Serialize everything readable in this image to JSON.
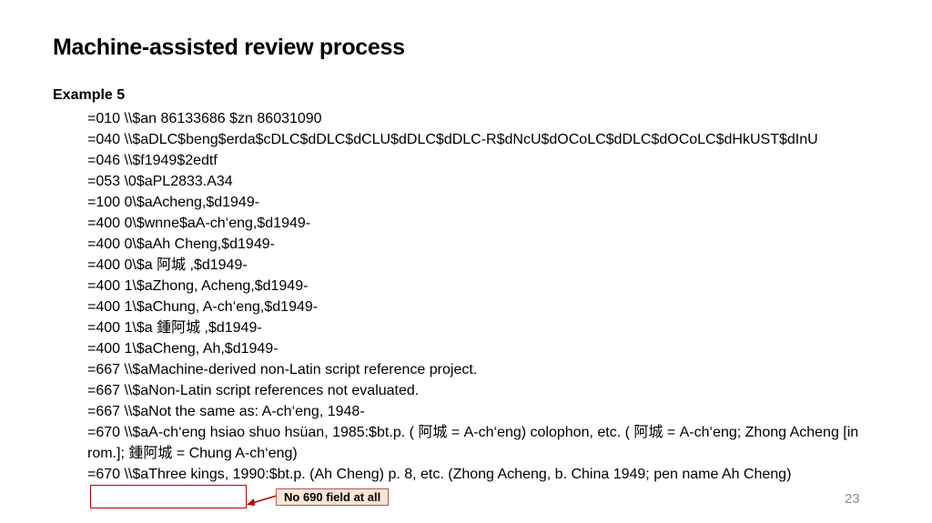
{
  "slide": {
    "title": "Machine-assisted review process",
    "example_label": "Example 5",
    "lines": [
      "=010  \\\\$an  86133686 $zn  86031090",
      "=040  \\\\$aDLC$beng$erda$cDLC$dDLC$dCLU$dDLC$dDLC-R$dNcU$dOCoLC$dDLC$dOCoLC$dHkUST$dInU",
      "=046  \\\\$f1949$2edtf",
      "=053  \\0$aPL2833.A34",
      "=100  0\\$aAcheng,$d1949-",
      "=400  0\\$wnne$aA-ch‘eng,$d1949-",
      "=400  0\\$aAh Cheng,$d1949-",
      "=400  0\\$a 阿城 ,$d1949-",
      "=400  1\\$aZhong, Acheng,$d1949-",
      "=400  1\\$aChung, A-ch‘eng,$d1949-",
      "=400  1\\$a 鍾阿城 ,$d1949-",
      "=400  1\\$aCheng, Ah,$d1949-",
      "=667  \\\\$aMachine-derived non-Latin script reference project.",
      "=667  \\\\$aNon-Latin script references not evaluated.",
      "=667  \\\\$aNot the same as: A-ch‘eng, 1948-",
      "=670  \\\\$aA-ch‘eng hsiao shuo hsüan, 1985:$bt.p. ( 阿城  = A-ch‘eng) colophon, etc. ( 阿城  = A-ch‘eng; Zhong Acheng [in rom.];  鍾阿城  = Chung A-ch‘eng)",
      "=670  \\\\$aThree kings, 1990:$bt.p. (Ah Cheng) p. 8, etc. (Zhong Acheng, b. China 1949; pen name Ah Cheng)"
    ],
    "callout": "No 690 field at all",
    "page_number": "23",
    "colors": {
      "box_border": "#c00000",
      "callout_fill": "#fbe5d6",
      "callout_border": "#c0504d"
    }
  }
}
